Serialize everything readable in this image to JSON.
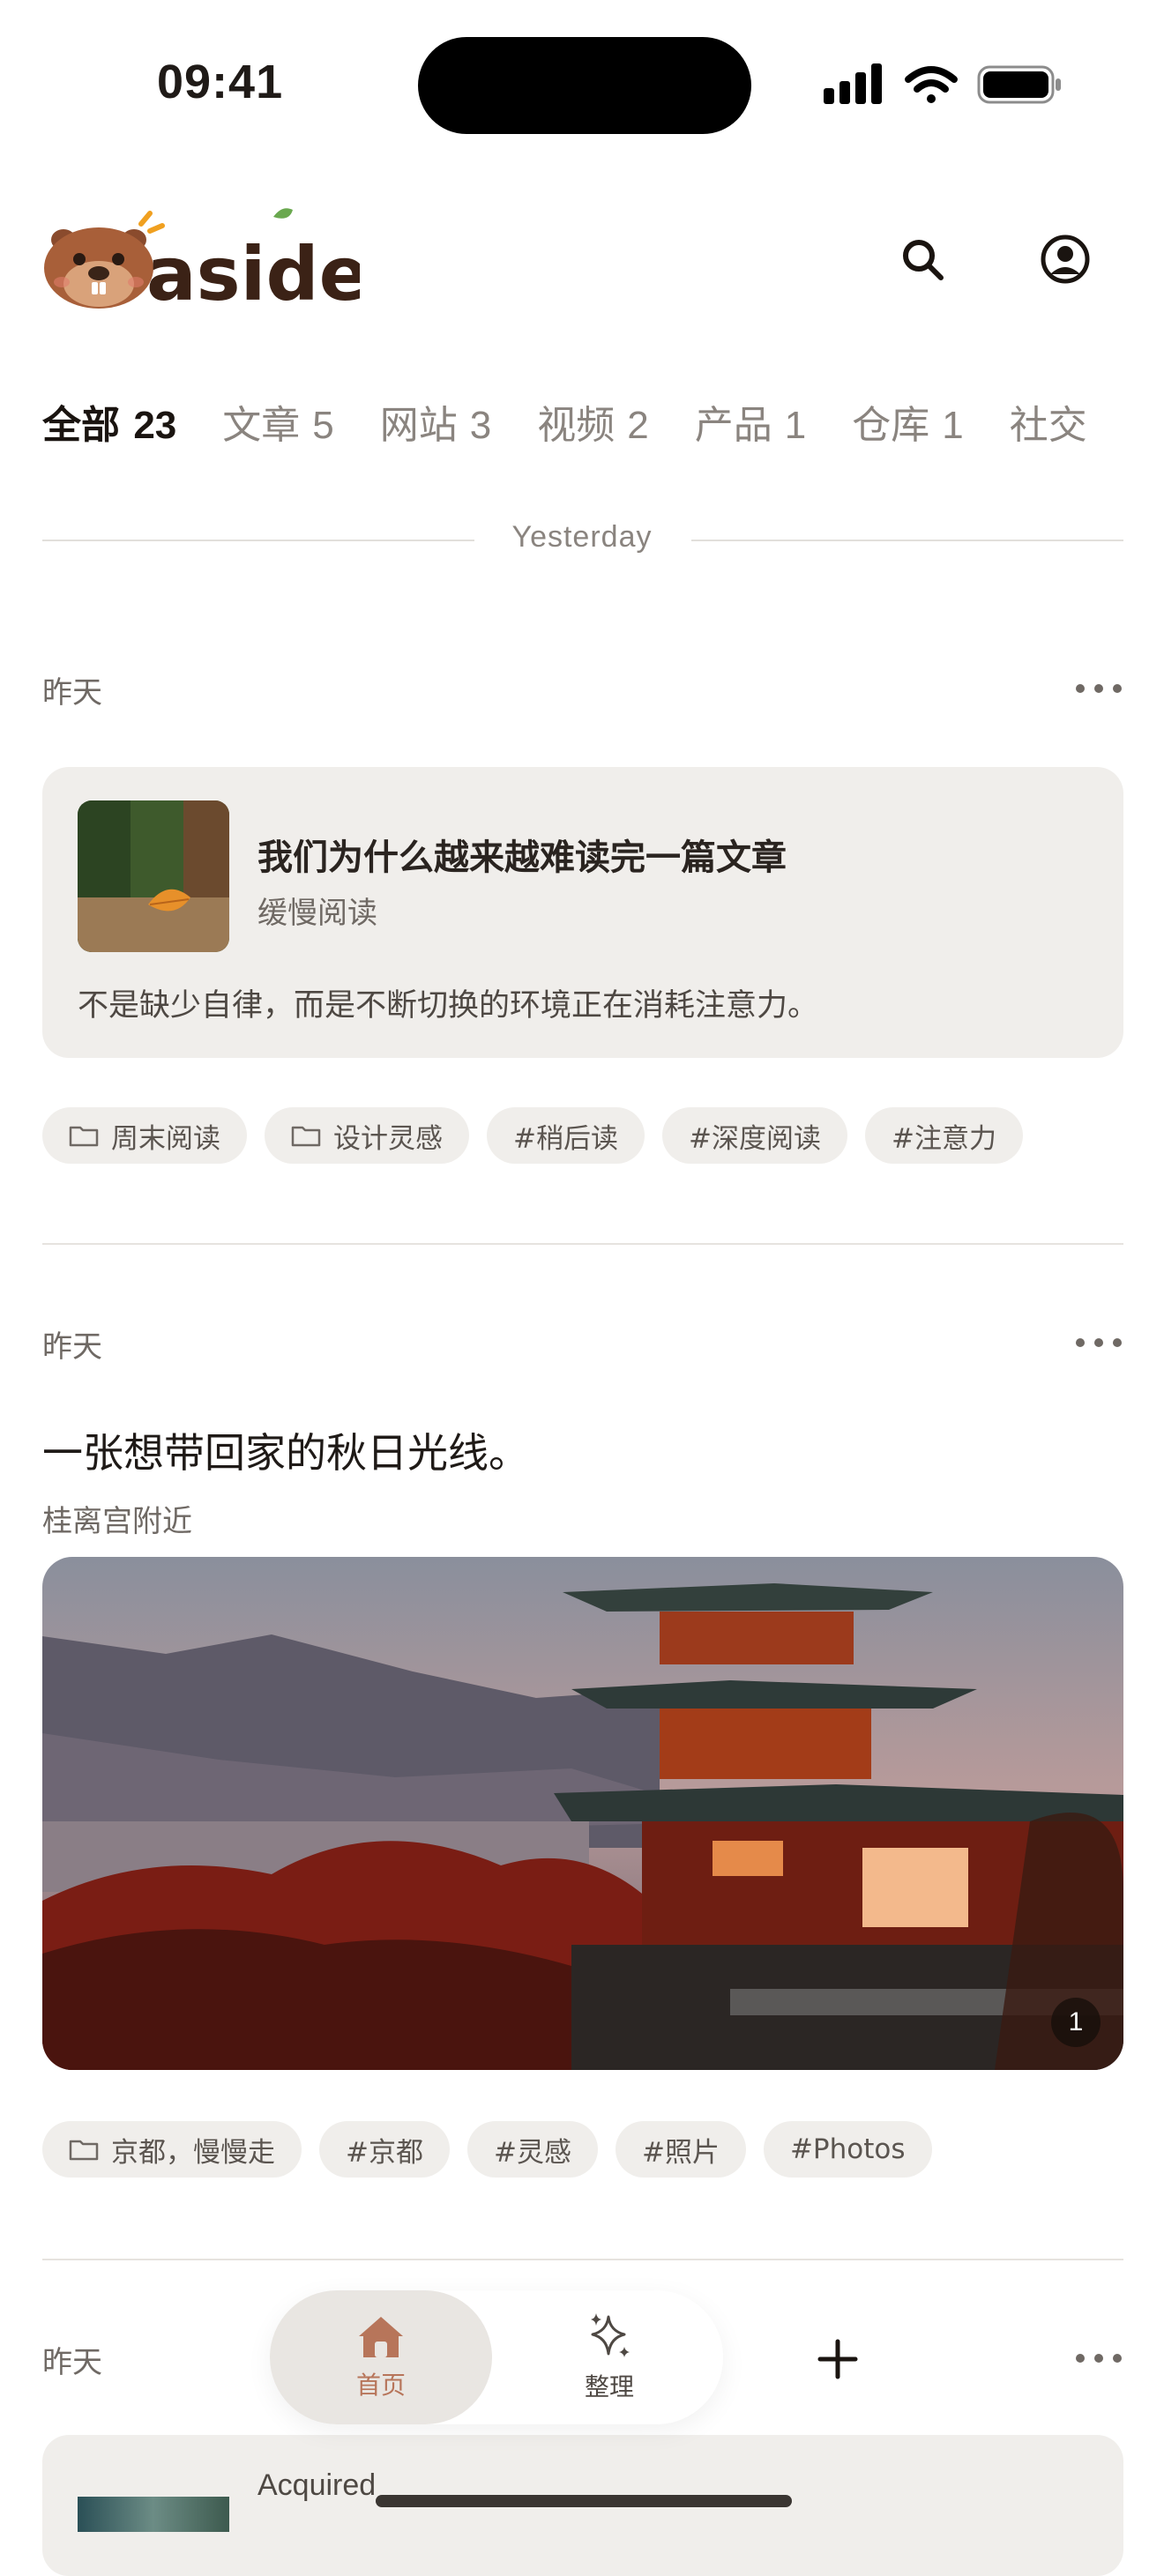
{
  "status_bar": {
    "time": "09:41"
  },
  "header": {
    "logo_text": "aside",
    "search_icon": "search-icon",
    "profile_icon": "profile-icon"
  },
  "tabs": [
    {
      "label": "全部",
      "count": "23",
      "active": true
    },
    {
      "label": "文章",
      "count": "5"
    },
    {
      "label": "网站",
      "count": "3"
    },
    {
      "label": "视频",
      "count": "2"
    },
    {
      "label": "产品",
      "count": "1"
    },
    {
      "label": "仓库",
      "count": "1"
    },
    {
      "label": "社交",
      "count": ""
    }
  ],
  "divider": {
    "label": "Yesterday"
  },
  "feed": [
    {
      "date": "昨天",
      "card": {
        "title": "我们为什么越来越难读完一篇文章",
        "subtitle": "缓慢阅读",
        "description": "不是缺少自律，而是不断切换的环境正在消耗注意力。"
      },
      "tags": [
        {
          "label": "周末阅读",
          "folder": true
        },
        {
          "label": "设计灵感",
          "folder": true
        },
        {
          "label": "#稍后读"
        },
        {
          "label": "#深度阅读"
        },
        {
          "label": "#注意力"
        }
      ]
    },
    {
      "date": "昨天",
      "title": "一张想带回家的秋日光线。",
      "subtitle": "桂离宫附近",
      "photo_count": "1",
      "tags": [
        {
          "label": "京都，慢慢走",
          "folder": true
        },
        {
          "label": "#京都"
        },
        {
          "label": "#灵感"
        },
        {
          "label": "#照片"
        },
        {
          "label": "#Photos"
        }
      ]
    },
    {
      "date": "昨天",
      "card_title": "Acquired"
    }
  ],
  "nav": {
    "home": "首页",
    "organize": "整理",
    "add_icon": "plus-icon"
  },
  "colors": {
    "accent": "#b7755a",
    "card_bg": "#f0eeeb",
    "text_muted": "#8a847f"
  }
}
